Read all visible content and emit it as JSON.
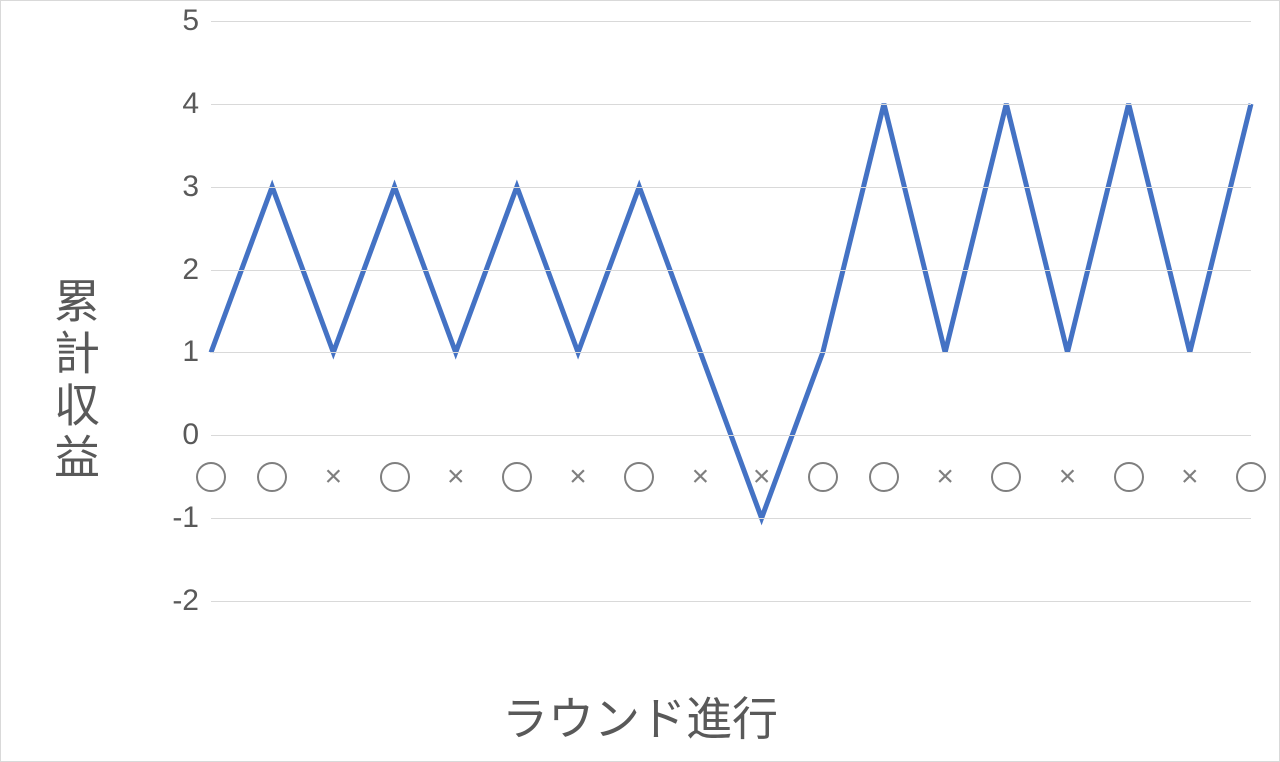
{
  "chart_data": {
    "type": "line",
    "title": "",
    "xlabel": "ラウンド進行",
    "ylabel": "累計収益",
    "ylim": [
      -2,
      5
    ],
    "yticks": [
      -2,
      -1,
      0,
      1,
      2,
      3,
      4,
      5
    ],
    "x": [
      1,
      2,
      3,
      4,
      5,
      6,
      7,
      8,
      9,
      10,
      11,
      12,
      13,
      14,
      15,
      16,
      17,
      18
    ],
    "series": [
      {
        "name": "累計収益",
        "values": [
          1,
          3,
          1,
          3,
          1,
          3,
          1,
          3,
          1,
          -1,
          1,
          4,
          1,
          4,
          1,
          4,
          1,
          4
        ],
        "color": "#4472C4"
      }
    ],
    "round_results": [
      "○",
      "○",
      "×",
      "○",
      "×",
      "○",
      "×",
      "○",
      "×",
      "×",
      "○",
      "○",
      "×",
      "○",
      "×",
      "○",
      "×",
      "○"
    ],
    "marker_y": -0.5
  },
  "axis_labels": {
    "x": "ラウンド進行",
    "y": "累計収益"
  }
}
